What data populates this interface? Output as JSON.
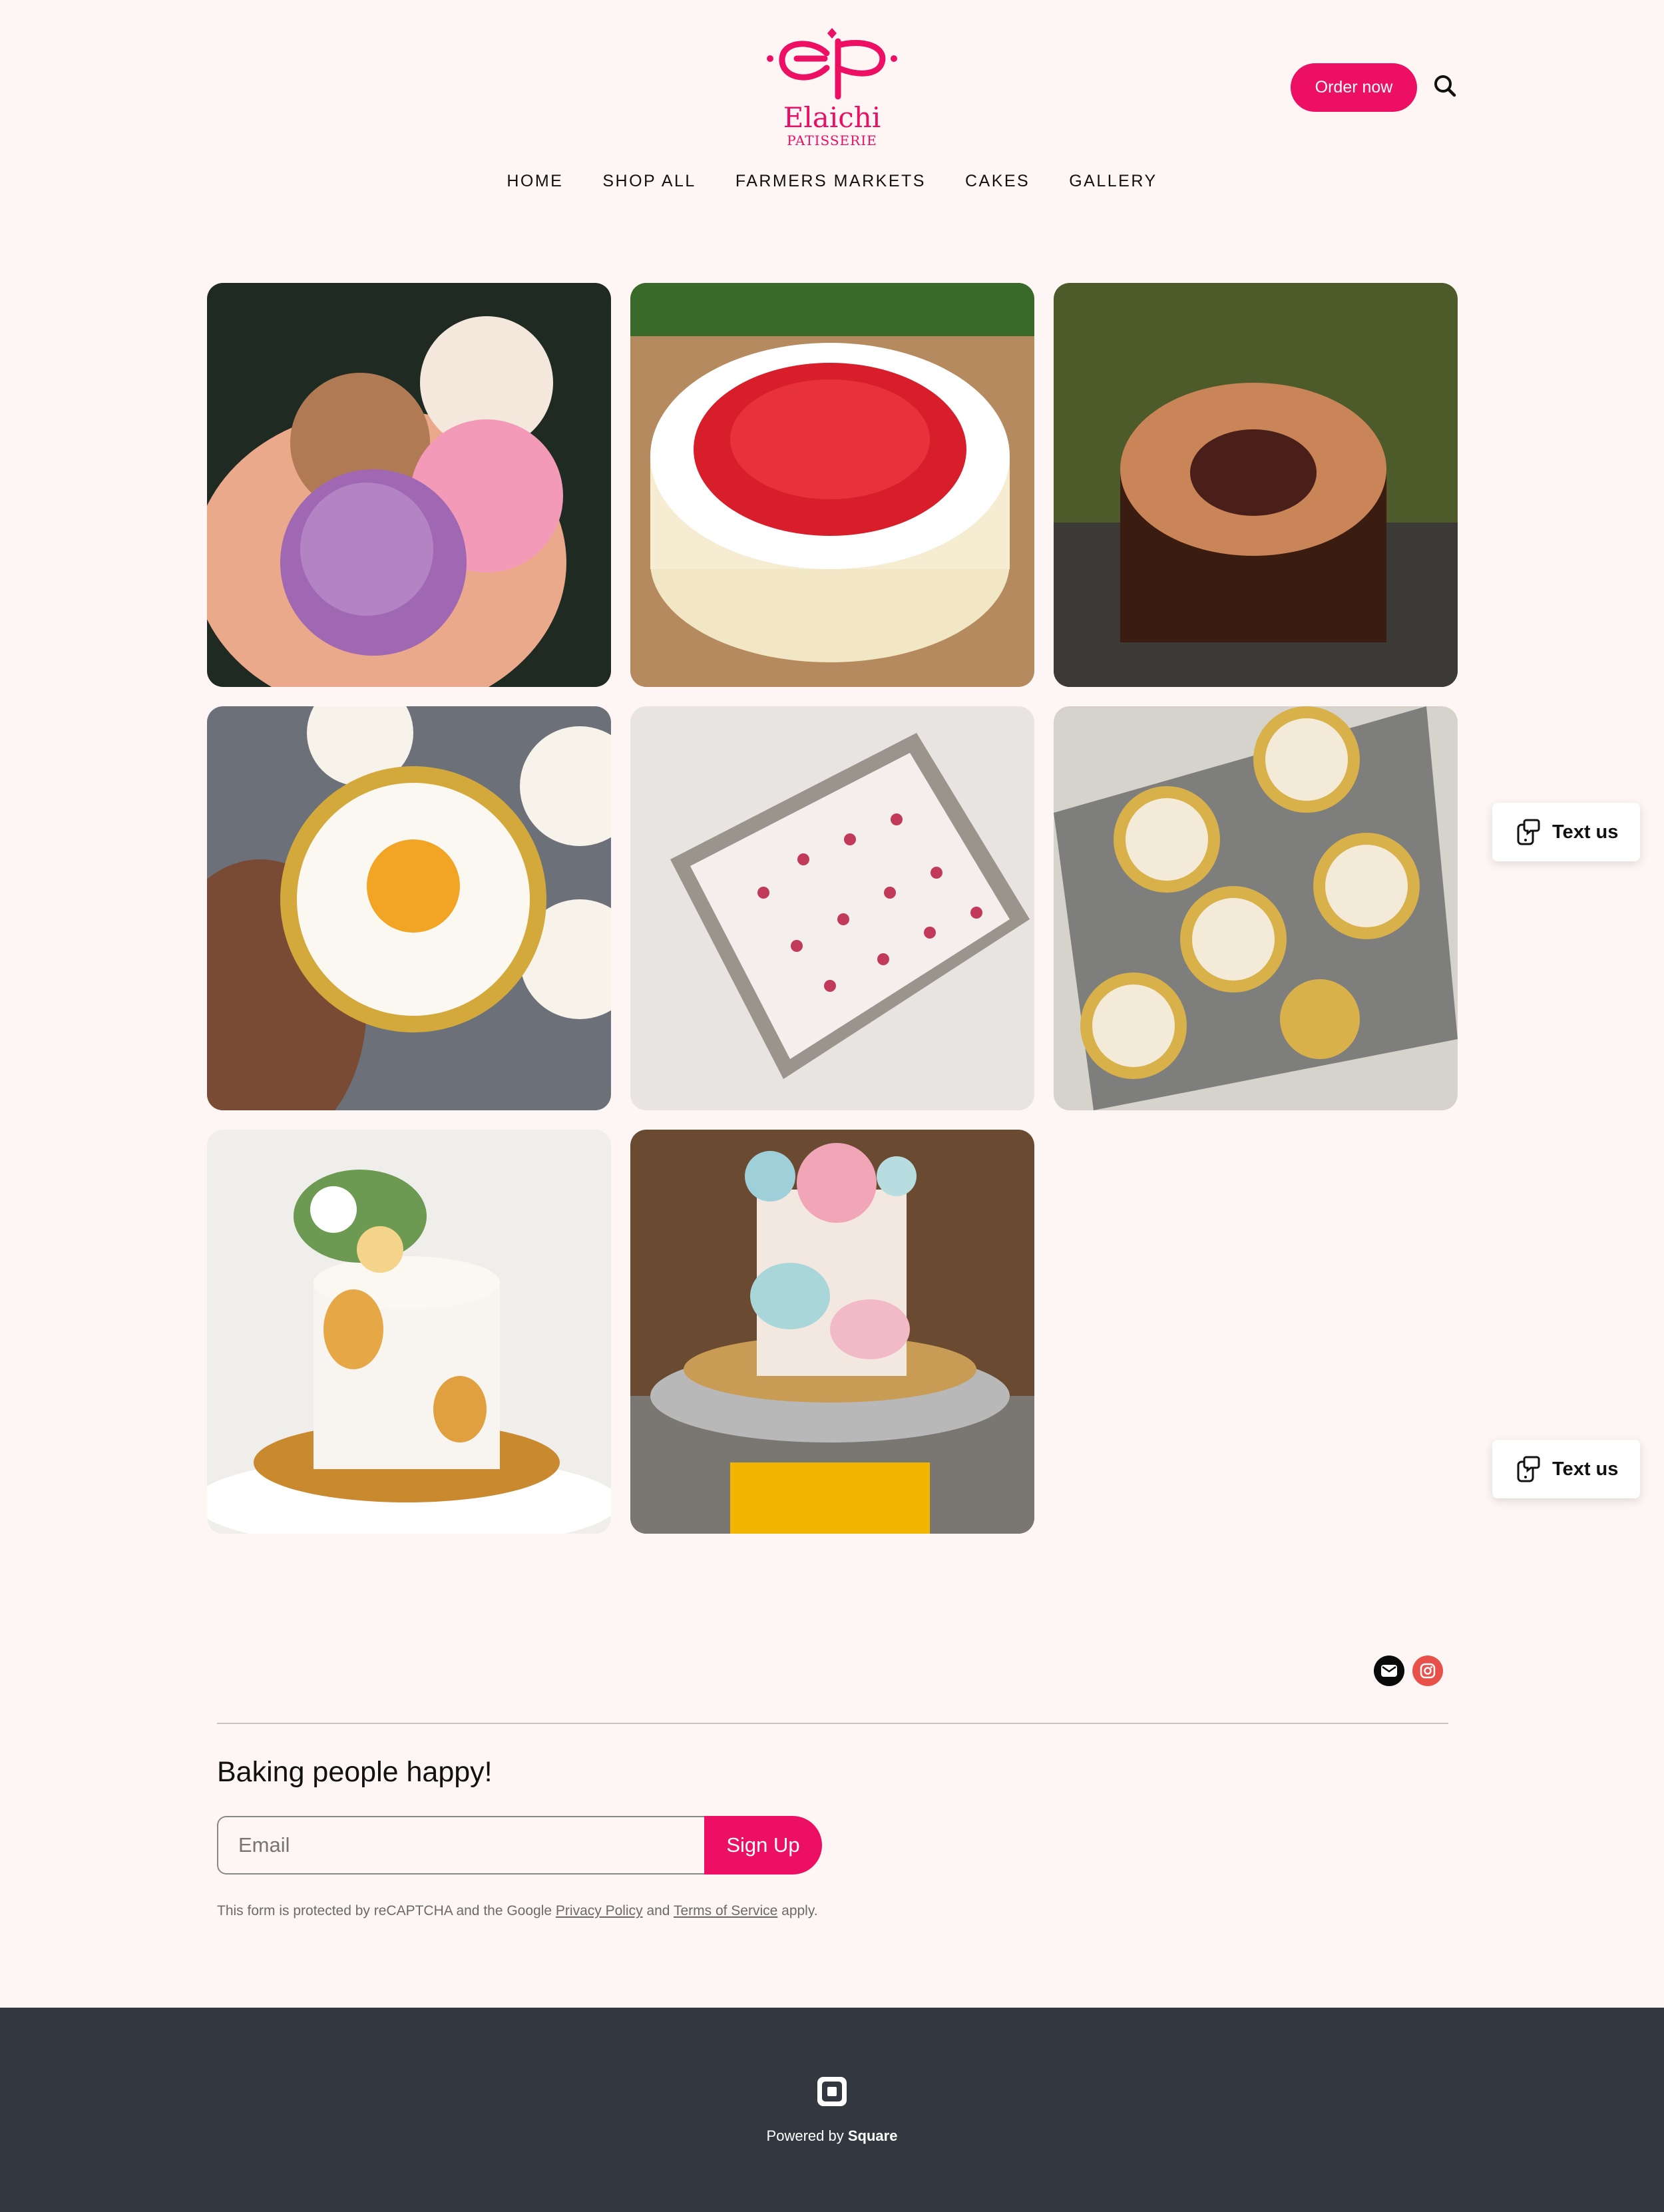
{
  "brand": {
    "name": "Elaichi",
    "subtitle": "PATISSERIE",
    "color": "#ec0f63"
  },
  "header": {
    "order_label": "Order now"
  },
  "nav": {
    "items": [
      "HOME",
      "SHOP ALL",
      "FARMERS MARKETS",
      "CAKES",
      "GALLERY"
    ]
  },
  "gallery": {
    "items": [
      {
        "subject": "macarons in hand"
      },
      {
        "subject": "strawberry cream cake"
      },
      {
        "subject": "chocolate caramel cake"
      },
      {
        "subject": "mango cream tarts"
      },
      {
        "subject": "rose coconut truffles"
      },
      {
        "subject": "heart-shaped rose tarts"
      },
      {
        "subject": "white and gold floral cake with macarons"
      },
      {
        "subject": "Oh Baby pastel cake"
      }
    ]
  },
  "widget": {
    "text_us_label": "Text us"
  },
  "social": {
    "email_icon": "mail-icon",
    "instagram_icon": "instagram-icon",
    "instagram_color": "#e8514a"
  },
  "newsletter": {
    "heading": "Baking people happy!",
    "email_placeholder": "Email",
    "signup_label": "Sign Up",
    "recaptcha_prefix": "This form is protected by reCAPTCHA and the Google ",
    "privacy_label": "Privacy Policy",
    "and_text": " and ",
    "terms_label": "Terms of Service",
    "suffix": " apply."
  },
  "footer": {
    "powered_prefix": "Powered by",
    "powered_brand": "Square",
    "background": "#333840"
  }
}
